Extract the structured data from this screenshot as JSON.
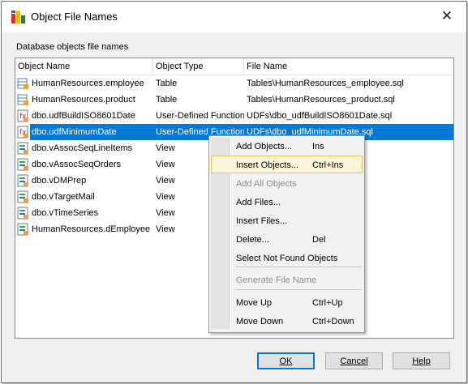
{
  "window": {
    "title": "Object File Names"
  },
  "caption": "Database objects file names",
  "columns": [
    "Object Name",
    "Object Type",
    "File Name"
  ],
  "rows": [
    {
      "name": "HumanResources.employee",
      "type": "Table",
      "file": "Tables\\HumanResources_employee.sql",
      "icon": "table-icon"
    },
    {
      "name": "HumanResources.product",
      "type": "Table",
      "file": "Tables\\HumanResources_product.sql",
      "icon": "table-icon"
    },
    {
      "name": "dbo.udfBuildISO8601Date",
      "type": "User-Defined Function",
      "file": "UDFs\\dbo_udfBuildISO8601Date.sql",
      "icon": "function-icon"
    },
    {
      "name": "dbo.udfMinimumDate",
      "type": "User-Defined Function",
      "file": "UDFs\\dbo_udfMinimumDate.sql",
      "icon": "function-icon",
      "selected": true
    },
    {
      "name": "dbo.vAssocSeqLineItems",
      "type": "View",
      "file": "ems.sql",
      "icon": "view-icon"
    },
    {
      "name": "dbo.vAssocSeqOrders",
      "type": "View",
      "file": "s.sql",
      "icon": "view-icon"
    },
    {
      "name": "dbo.vDMPrep",
      "type": "View",
      "file": "",
      "icon": "view-icon"
    },
    {
      "name": "dbo.vTargetMail",
      "type": "View",
      "file": "",
      "icon": "view-icon"
    },
    {
      "name": "dbo.vTimeSeries",
      "type": "View",
      "file": "",
      "icon": "view-icon"
    },
    {
      "name": "HumanResources.dEmployee",
      "type": "View",
      "file": "ployee.sql",
      "icon": "view-icon"
    }
  ],
  "context_menu": [
    {
      "label": "Add Objects...",
      "shortcut": "Ins"
    },
    {
      "label": "Insert Objects...",
      "shortcut": "Ctrl+Ins",
      "highlighted": true
    },
    {
      "label": "Add All Objects",
      "shortcut": "",
      "disabled": true
    },
    {
      "label": "Add Files...",
      "shortcut": ""
    },
    {
      "label": "Insert Files...",
      "shortcut": ""
    },
    {
      "label": "Delete...",
      "shortcut": "Del"
    },
    {
      "label": "Select Not Found Objects",
      "shortcut": ""
    },
    {
      "label": "Generate File Name",
      "shortcut": "",
      "disabled": true
    },
    {
      "label": "Move Up",
      "shortcut": "Ctrl+Up"
    },
    {
      "label": "Move Down",
      "shortcut": "Ctrl+Down"
    }
  ],
  "buttons": {
    "ok": "OK",
    "cancel": "Cancel",
    "help": "Help"
  },
  "colors": {
    "selection": "#0078d7",
    "menu_highlight": "#fcf5d9"
  }
}
